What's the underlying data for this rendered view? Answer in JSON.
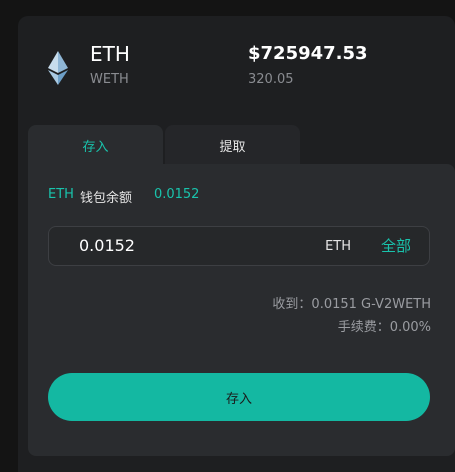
{
  "token": {
    "symbol": "ETH",
    "subtitle": "WETH",
    "icon": "ethereum-icon",
    "price": "$725947.53",
    "price_sub": "320.05"
  },
  "tabs": [
    {
      "label": "存入",
      "active": true
    },
    {
      "label": "提取",
      "active": false
    }
  ],
  "balance": {
    "token": "ETH",
    "label": "钱包余额",
    "value": "0.0152"
  },
  "amount": {
    "value": "0.0152",
    "unit": "ETH",
    "max_label": "全部"
  },
  "info": {
    "receive": "收到：0.0151 G-V2WETH",
    "fee": "手续费：0.00%"
  },
  "submit_label": "存入",
  "colors": {
    "accent": "#19c3ac",
    "button": "#14b8a2",
    "panel": "#2a2c2f",
    "card": "#1e1f21"
  }
}
